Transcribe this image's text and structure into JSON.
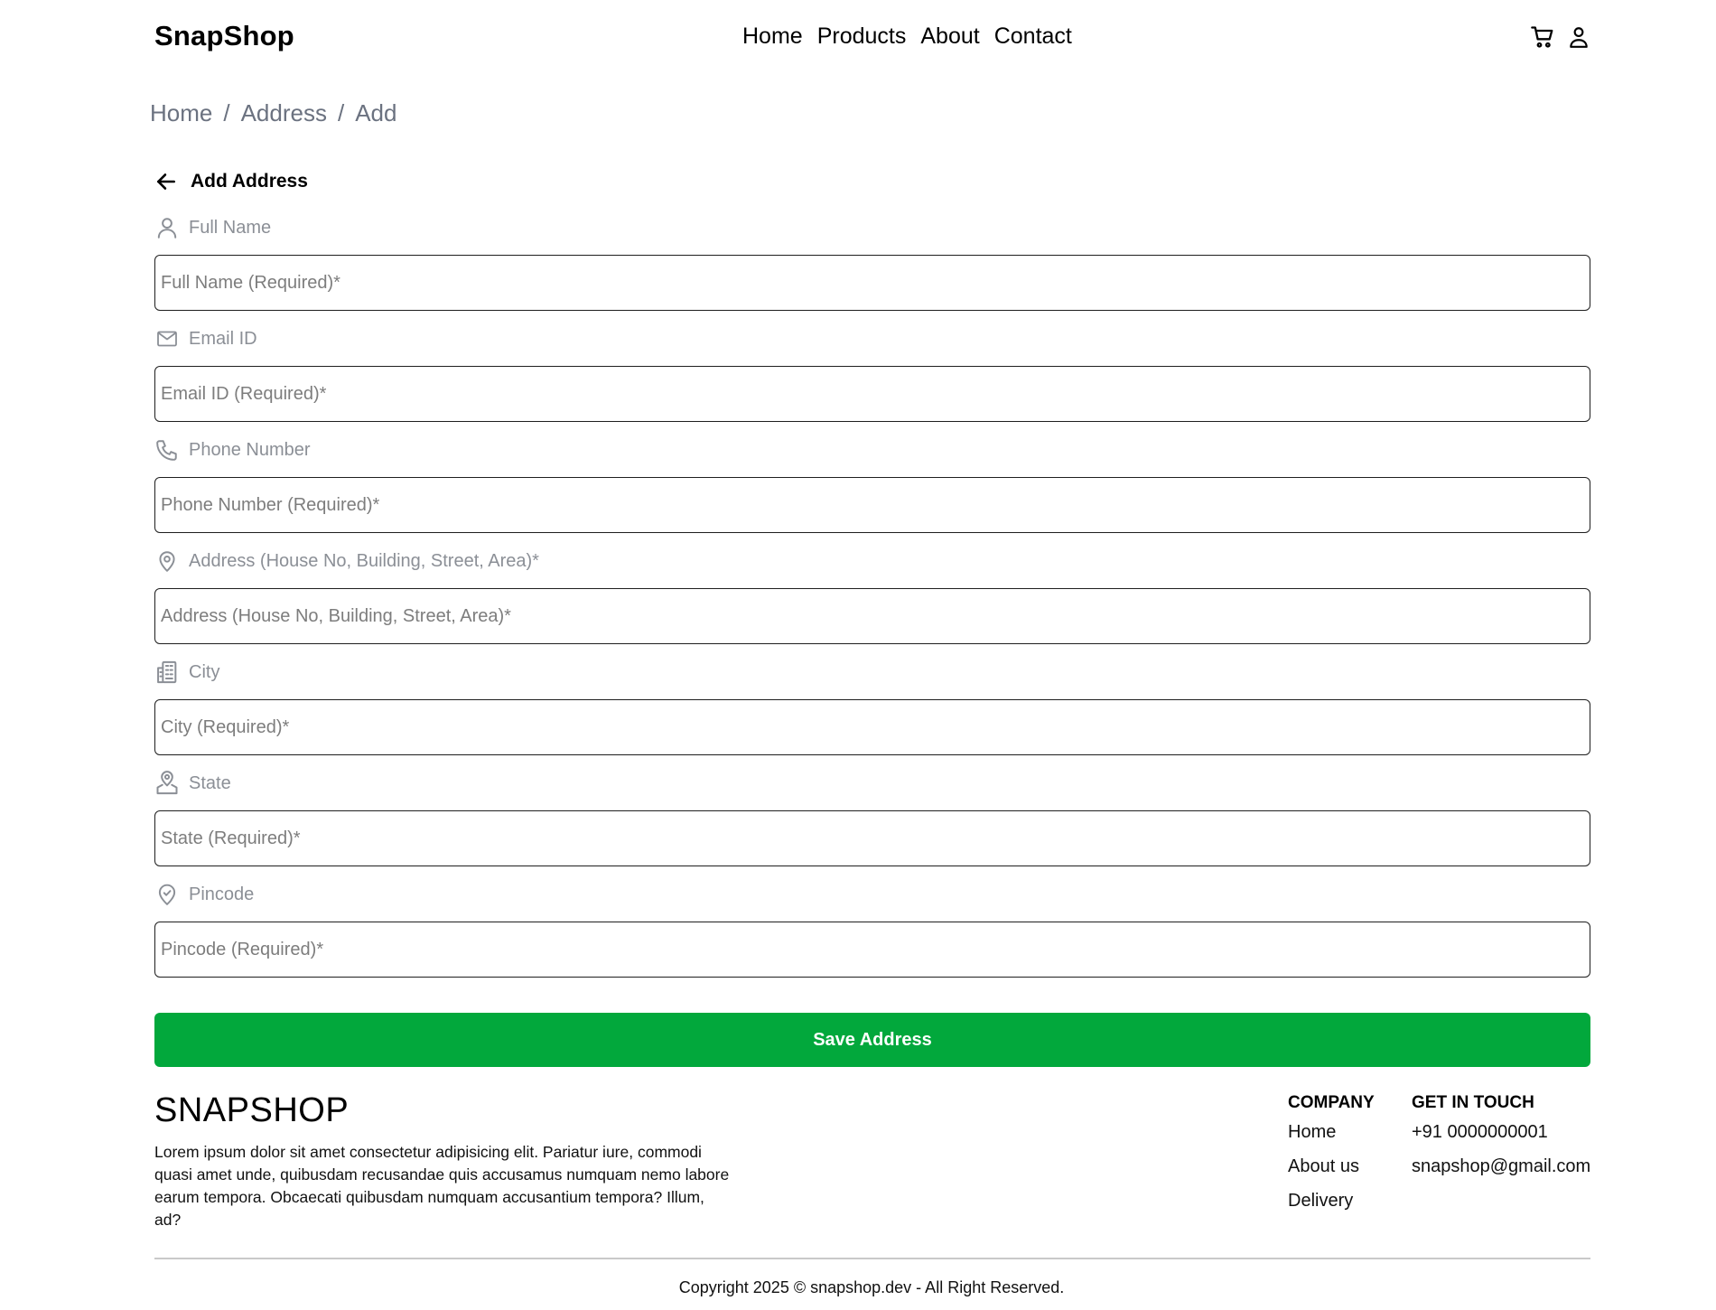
{
  "header": {
    "logo": "SnapShop",
    "nav": [
      "Home",
      "Products",
      "About",
      "Contact"
    ],
    "icons": [
      "cart-icon",
      "user-icon"
    ]
  },
  "breadcrumb": [
    "Home",
    "Address",
    "Add"
  ],
  "form": {
    "title": "Add Address",
    "fields": [
      {
        "label": "Full Name",
        "placeholder": "Full Name (Required)*",
        "icon": "user-icon"
      },
      {
        "label": "Email ID",
        "placeholder": "Email ID (Required)*",
        "icon": "mail-icon"
      },
      {
        "label": "Phone Number",
        "placeholder": "Phone Number (Required)*",
        "icon": "phone-icon"
      },
      {
        "label": "Address (House No, Building, Street, Area)*",
        "placeholder": "Address (House No, Building, Street, Area)*",
        "icon": "map-pin-icon"
      },
      {
        "label": "City",
        "placeholder": "City (Required)*",
        "icon": "building-icon"
      },
      {
        "label": "State",
        "placeholder": "State (Required)*",
        "icon": "map-user-icon"
      },
      {
        "label": "Pincode",
        "placeholder": "Pincode (Required)*",
        "icon": "pin-check-icon"
      }
    ],
    "submit_label": "Save Address"
  },
  "footer": {
    "brand": "SNAPSHOP",
    "description": "Lorem ipsum dolor sit amet consectetur adipisicing elit. Pariatur iure, commodi quasi amet unde, quibusdam recusandae quis accusamus numquam nemo labore earum tempora. Obcaecati quibusdam numquam accusantium tempora? Illum, ad?",
    "company": {
      "heading": "COMPANY",
      "links": [
        "Home",
        "About us",
        "Delivery"
      ]
    },
    "contact": {
      "heading": "GET IN TOUCH",
      "phone": "+91 0000000001",
      "email": "snapshop@gmail.com"
    },
    "copyright": "Copyright 2025 © snapshop.dev - All Right Reserved."
  },
  "colors": {
    "accent": "#02a83c",
    "muted_text": "#8b8f96",
    "breadcrumb": "#6b7280"
  }
}
